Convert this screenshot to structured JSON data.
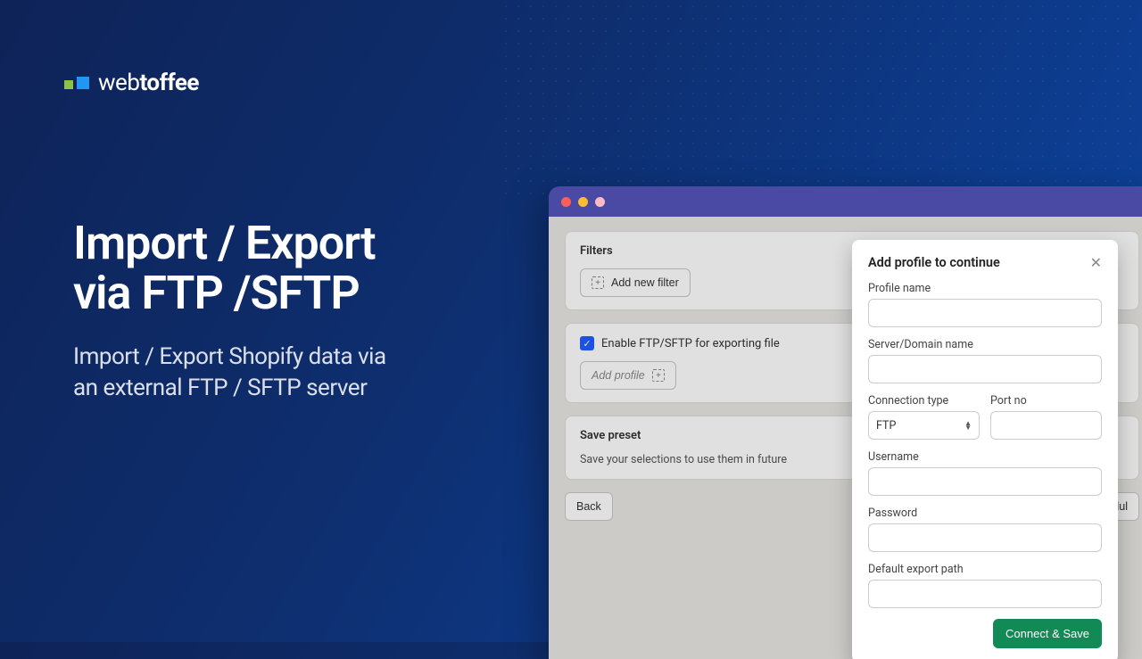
{
  "brand": {
    "name": "webtoffee"
  },
  "hero": {
    "title_line1": "Import / Export",
    "title_line2": "via FTP /SFTP",
    "subtitle_line1": "Import / Export Shopify data via",
    "subtitle_line2": "an external FTP / SFTP server"
  },
  "app": {
    "filters": {
      "title": "Filters",
      "add_button": "Add new filter"
    },
    "ftp": {
      "checkbox_label": "Enable FTP/SFTP for exporting file",
      "add_profile_button": "Add profile"
    },
    "preset": {
      "title": "Save preset",
      "subtitle": "Save your selections to use them in future"
    },
    "buttons": {
      "back": "Back",
      "schedule": "Schedul"
    }
  },
  "modal": {
    "title": "Add profile to continue",
    "fields": {
      "profile_name": "Profile name",
      "server_name": "Server/Domain name",
      "connection_type": "Connection type",
      "connection_type_value": "FTP",
      "port": "Port no",
      "username": "Username",
      "password": "Password",
      "export_path": "Default export path"
    },
    "submit": "Connect & Save"
  }
}
